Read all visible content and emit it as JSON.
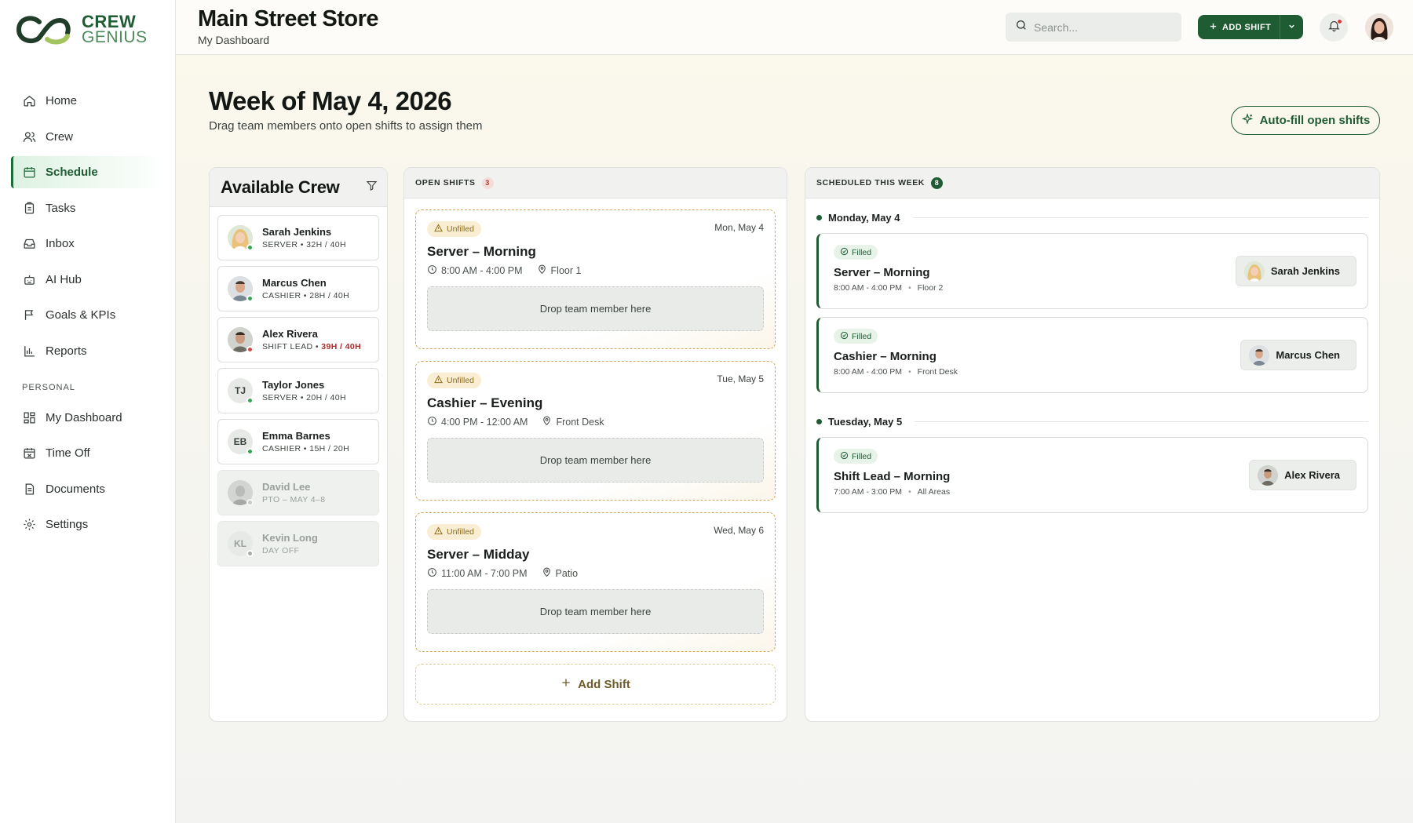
{
  "brand": {
    "name_top": "CREW",
    "name_bottom": "GENIUS",
    "colors": {
      "primary": "#1f5c33",
      "accent": "#a3c45c",
      "warning": "#d4a757",
      "danger": "#b02a2a"
    }
  },
  "sidebar": {
    "items": [
      {
        "label": "Home",
        "icon": "home-icon"
      },
      {
        "label": "Crew",
        "icon": "users-icon"
      },
      {
        "label": "Schedule",
        "icon": "calendar-icon",
        "active": true
      },
      {
        "label": "Tasks",
        "icon": "clipboard-icon"
      },
      {
        "label": "Inbox",
        "icon": "inbox-icon"
      },
      {
        "label": "AI Hub",
        "icon": "robot-icon"
      },
      {
        "label": "Goals & KPIs",
        "icon": "flag-icon"
      },
      {
        "label": "Reports",
        "icon": "bar-chart-icon"
      }
    ],
    "personal_label": "PERSONAL",
    "personal_items": [
      {
        "label": "My Dashboard",
        "icon": "dashboard-icon"
      },
      {
        "label": "Time Off",
        "icon": "calendar-off-icon"
      },
      {
        "label": "Documents",
        "icon": "document-icon"
      },
      {
        "label": "Settings",
        "icon": "gear-icon"
      }
    ]
  },
  "header": {
    "title": "Main Street Store",
    "subtitle": "My Dashboard",
    "search_placeholder": "Search...",
    "add_shift_label": "ADD SHIFT"
  },
  "page": {
    "title": "Week of May 4, 2026",
    "subtitle": "Drag team members onto open shifts to assign them",
    "autofill_label": "Auto-fill open shifts"
  },
  "crew_panel": {
    "title": "Available Crew",
    "members": [
      {
        "name": "Sarah Jenkins",
        "role": "SERVER",
        "hours": "32H / 40H",
        "status": "available",
        "status_color": "#3aa457"
      },
      {
        "name": "Marcus Chen",
        "role": "CASHIER",
        "hours": "28H / 40H",
        "status": "available",
        "status_color": "#3aa457"
      },
      {
        "name": "Alex Rivera",
        "role": "SHIFT LEAD",
        "hours": "39H / 40H",
        "hours_warning": true,
        "status": "near-limit",
        "status_color": "#d24a4a"
      },
      {
        "name": "Taylor Jones",
        "initials": "TJ",
        "role": "SERVER",
        "hours": "20H / 40H",
        "status": "available",
        "status_color": "#3aa457"
      },
      {
        "name": "Emma Barnes",
        "initials": "EB",
        "role": "CASHIER",
        "hours": "15H / 20H",
        "status": "available",
        "status_color": "#3aa457"
      },
      {
        "name": "David Lee",
        "meta": "PTO – MAY 4–8",
        "status": "unavailable",
        "status_color": "#a8aca9"
      },
      {
        "name": "Kevin Long",
        "initials": "KL",
        "meta": "DAY OFF",
        "status": "unavailable",
        "status_color": "#a8aca9"
      }
    ]
  },
  "open_shifts": {
    "label": "OPEN SHIFTS",
    "count": "3",
    "unfilled_label": "Unfilled",
    "drop_label": "Drop team member here",
    "add_label": "Add Shift",
    "shifts": [
      {
        "date": "Mon, May 4",
        "name": "Server – Morning",
        "time": "8:00 AM - 4:00 PM",
        "location": "Floor 1"
      },
      {
        "date": "Tue, May 5",
        "name": "Cashier – Evening",
        "time": "4:00 PM - 12:00 AM",
        "location": "Front Desk"
      },
      {
        "date": "Wed, May 6",
        "name": "Server – Midday",
        "time": "11:00 AM - 7:00 PM",
        "location": "Patio"
      }
    ]
  },
  "scheduled": {
    "label": "SCHEDULED THIS WEEK",
    "count": "8",
    "filled_label": "Filled",
    "days": [
      {
        "day": "Monday, May 4",
        "shifts": [
          {
            "name": "Server – Morning",
            "time": "8:00 AM - 4:00 PM",
            "location": "Floor 2",
            "assignee": "Sarah Jenkins"
          },
          {
            "name": "Cashier – Morning",
            "time": "8:00 AM - 4:00 PM",
            "location": "Front Desk",
            "assignee": "Marcus Chen"
          }
        ]
      },
      {
        "day": "Tuesday, May 5",
        "shifts": [
          {
            "name": "Shift Lead – Morning",
            "time": "7:00 AM - 3:00 PM",
            "location": "All Areas",
            "assignee": "Alex Rivera"
          }
        ]
      }
    ]
  }
}
